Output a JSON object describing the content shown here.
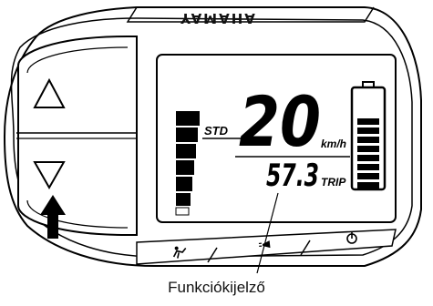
{
  "device": {
    "brand": "YAMAHA",
    "assist_mode": "STD",
    "speed": "20",
    "speed_unit": "km/h",
    "function_value": "57.3",
    "function_label": "TRIP",
    "assist_level_fraction": 0.8,
    "battery_level_fraction": 0.75,
    "buttons": {
      "up": "up-arrow-icon",
      "down": "down-arrow-icon",
      "walk_assist": "walk-assist-icon",
      "light": "light-icon",
      "power": "power-icon"
    }
  },
  "callout": {
    "label": "Funkciókijelző"
  }
}
